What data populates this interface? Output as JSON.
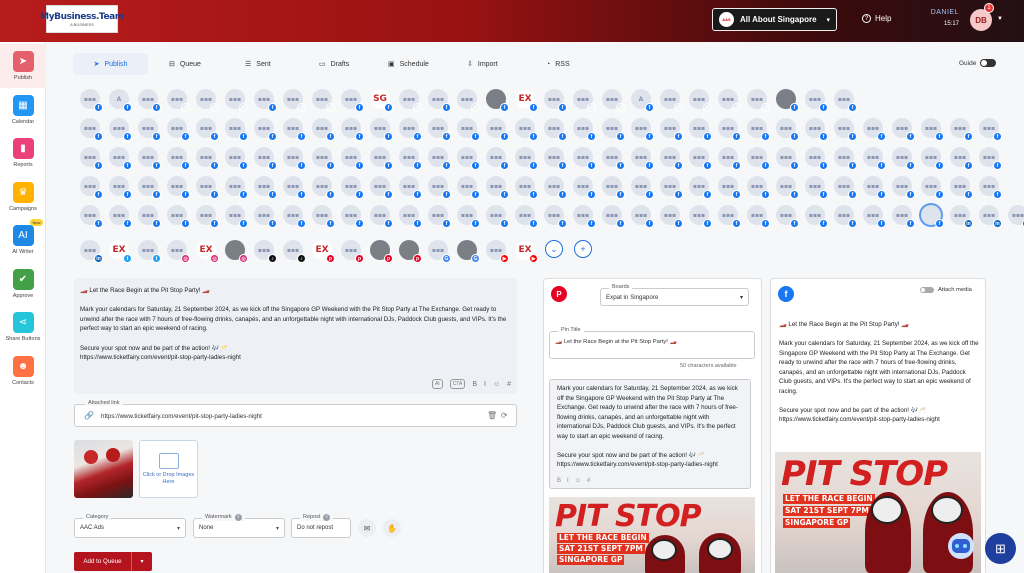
{
  "header": {
    "logo_text": "MyBusiness.Team",
    "logo_sub": "A BUSINESS",
    "brand": "All About Singapore",
    "brand_icon": "AAS",
    "help": "Help",
    "user_name": "DANIEL",
    "time": "15:17",
    "avatar": "DB",
    "notif_count": "1"
  },
  "sidebar": {
    "items": [
      {
        "label": "Publish",
        "icon": "paper-plane-icon",
        "color": "#e4606a"
      },
      {
        "label": "Calendar",
        "icon": "calendar-icon",
        "color": "#2196f3"
      },
      {
        "label": "Reports",
        "icon": "bar-chart-icon",
        "color": "#ec407a"
      },
      {
        "label": "Campaigns",
        "icon": "trophy-icon",
        "color": "#ffb300"
      },
      {
        "label": "AI Writer",
        "icon": "ai-icon",
        "color": "#1e88e5",
        "badge": "New"
      },
      {
        "label": "Approve",
        "icon": "check-icon",
        "color": "#43a047"
      },
      {
        "label": "Share Buttons",
        "icon": "share-icon",
        "color": "#26c6da"
      },
      {
        "label": "Contacts",
        "icon": "contacts-icon",
        "color": "#ff7043"
      }
    ]
  },
  "tabs": [
    {
      "label": "Publish",
      "icon": "send-icon"
    },
    {
      "label": "Queue",
      "icon": "queue-icon"
    },
    {
      "label": "Sent",
      "icon": "list-icon"
    },
    {
      "label": "Drafts",
      "icon": "file-icon"
    },
    {
      "label": "Schedule",
      "icon": "schedule-icon"
    },
    {
      "label": "Import",
      "icon": "import-icon"
    },
    {
      "label": "RSS",
      "icon": "rss-icon"
    }
  ],
  "guide_label": "Guide",
  "accounts": {
    "rows": [
      "fb a-fb fb fb-aa fb-aa fb-aa fb fb-aa fb-aa fb sg-fb fb-aa fb fb-aa photo-fb ex-fb fb fb-aa fb-aa a-fb fb-aa fb-aa fb-aa fb-aa photo-fb fb fb",
      "fb fb fb fb fb fb fb fb fb fb fb fb fb fb fb fb fb fb fb fb fb fb fb fb fb fb fb fb fb fb fb fb",
      "fb fb fb fb fb fb fb fb fb fb fb fb fb fb fb fb fb fb fb fb fb fb fb fb fb fb fb fb fb fb fb fb",
      "fb fb fb fb fb fb fb fb fb fb fb fb fb fb fb fb fb fb fb fb fb fb fb fb fb fb fb fb fb fb fb fb",
      "fb fb fb fb fb fb fb fb fb fb fb fb fb fb fb fb fb fb fb fb fb fb fb fb fb fb fb fb fb sel-fb li li li",
      "li ex-tw tw ig ex-ig photo-ig tt tt ex-pi pi photo-pi photo-pi gm photo-gm yt ex-yt"
    ]
  },
  "composer": {
    "lines": [
      "🏎️ Let the Race Begin at the Pit Stop Party! 🏎️",
      "",
      "Mark your calendars for Saturday, 21 September 2024, as we kick off the Singapore GP Weekend with the Pit Stop Party at The Exchange. Get ready to unwind after the race with 7 hours of free-flowing drinks, canapés, and an unforgettable night with international DJs, Paddock Club guests, and VIPs. It's the perfect way to start an epic weekend of racing.",
      "",
      "Secure your spot now and be part of the action! 🎶🥂",
      "https://www.ticketfairy.com/event/pit-stop-party-ladies-night"
    ],
    "tools": [
      "AI",
      "CTA",
      "B",
      "I",
      "☺",
      "#"
    ]
  },
  "attached_link": {
    "label": "Attached link",
    "value": "https://www.ticketfairy.com/event/pit-stop-party-ladies-night"
  },
  "dropzone": "Click or Drop Images Here",
  "fields": {
    "category": {
      "label": "Category",
      "value": "AAC Ads"
    },
    "watermark": {
      "label": "Watermark",
      "value": "None"
    },
    "repost": {
      "label": "Repost",
      "value": "Do not repost"
    }
  },
  "queue_button": "Add to Queue",
  "pinterest": {
    "boards_label": "Boards",
    "board": "Expat in Singapore",
    "pin_title_label": "Pin Title",
    "pin_title": "🏎️ Let the Race Begin at the Pit Stop Party! 🏎️",
    "chars_left": "50 characters available",
    "body_lines": [
      "Mark your calendars for Saturday, 21 September 2024, as we kick off the Singapore GP Weekend with the Pit Stop Party at The Exchange. Get ready to unwind after the race with 7 hours of free-flowing drinks, canapés, and an unforgettable night with international DJs, Paddock Club guests, and VIPs. It's the perfect way to start an epic weekend of racing.",
      "",
      "Secure your spot now and be part of the action! 🎶🥂",
      "https://www.ticketfairy.com/event/pit-stop-party-ladies-night"
    ]
  },
  "facebook": {
    "attach_media": "Attach media",
    "lines": [
      "🏎️ Let the Race Begin at the Pit Stop Party! 🏎️",
      "",
      "Mark your calendars for Saturday, 21 September 2024, as we kick off the Singapore GP Weekend with the Pit Stop Party at The Exchange. Get ready to unwind after the race with 7 hours of free-flowing drinks, canapés, and an unforgettable night with international DJs, Paddock Club guests, and VIPs. It's the perfect way to start an epic weekend of racing.",
      "",
      "Secure your spot now and be part of the action! 🎶🥂",
      "https://www.ticketfairy.com/event/pit-stop-party-ladies-night"
    ]
  },
  "poster": {
    "title": "PIT STOP",
    "line1": "LET THE RACE BEGIN",
    "line2": "SAT 21ST SEPT 7PM",
    "line3": "SINGAPORE GP"
  }
}
